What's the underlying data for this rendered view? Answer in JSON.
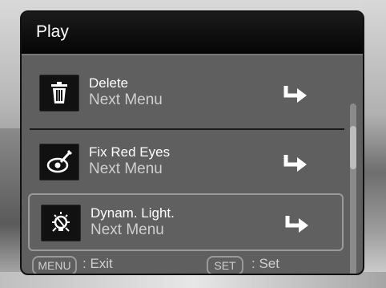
{
  "title": "Play",
  "items": [
    {
      "label": "Delete",
      "sub": "Next Menu",
      "icon": "trash-icon"
    },
    {
      "label": "Fix Red Eyes",
      "sub": "Next Menu",
      "icon": "red-eye-brush-icon"
    },
    {
      "label": "Dynam. Light.",
      "sub": "Next Menu",
      "icon": "light-bulb-icon",
      "selected": true
    }
  ],
  "footer": {
    "menu_key": "MENU",
    "menu_action": ": Exit",
    "set_key": "SET",
    "set_action": ": Set"
  },
  "colors": {
    "panel": "#5f5f5f",
    "titlebar": "#0a0a0a",
    "text": "#ffffff",
    "subtext": "#cfcfcf"
  }
}
